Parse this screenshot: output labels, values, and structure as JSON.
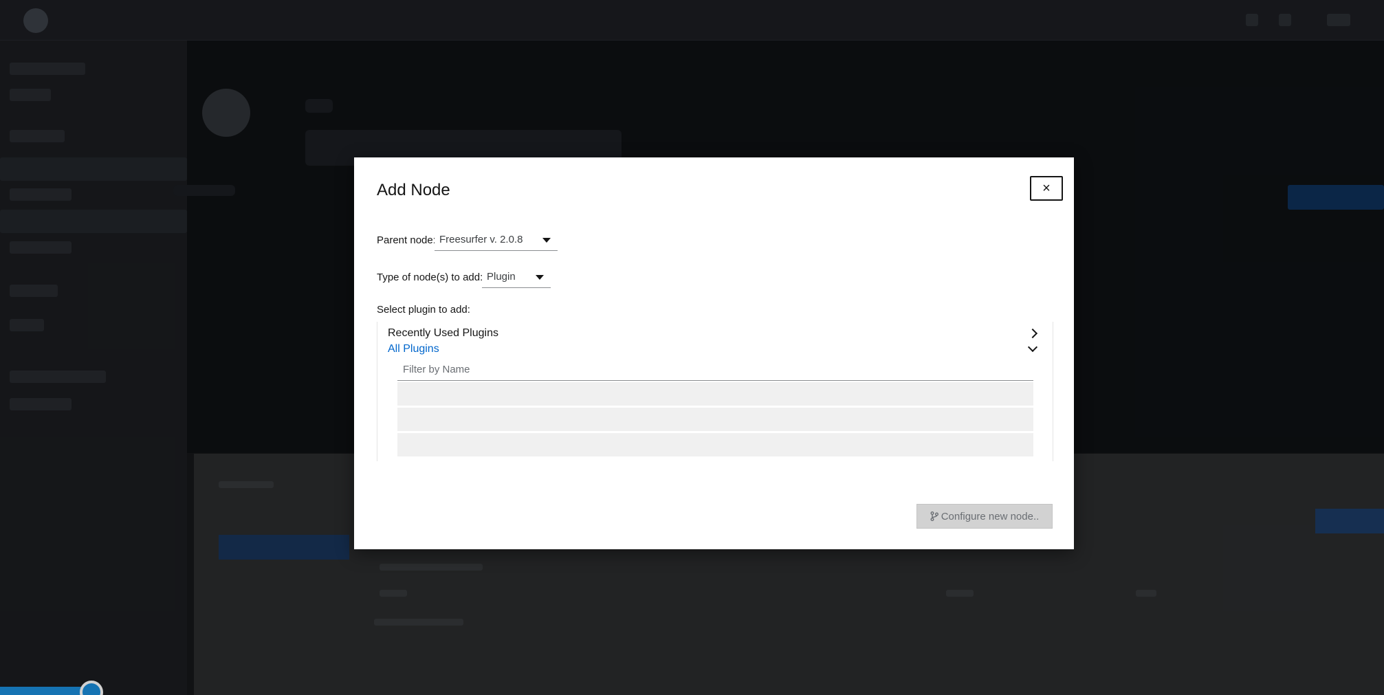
{
  "modal": {
    "title": "Add Node",
    "close_label": "×",
    "parent_node": {
      "label": "Parent node:",
      "selected": "Freesurfer v. 2.0.8"
    },
    "node_type": {
      "label": "Type of node(s) to add:",
      "selected": "Plugin"
    },
    "select_plugin_label": "Select plugin to add:",
    "groups": [
      {
        "label": "Recently Used Plugins",
        "expanded": false,
        "icon": "chevron-right-icon"
      },
      {
        "label": "All Plugins",
        "expanded": true,
        "icon": "chevron-down-icon"
      }
    ],
    "filter": {
      "placeholder": "Filter by Name",
      "value": ""
    },
    "configure_button": {
      "label": "Configure new node..",
      "icon": "code-branch-icon",
      "disabled": true
    }
  },
  "theme": {
    "link_color": "#0066cc",
    "overlay_bg": "#151719",
    "progress_color": "#1a8ddb"
  }
}
